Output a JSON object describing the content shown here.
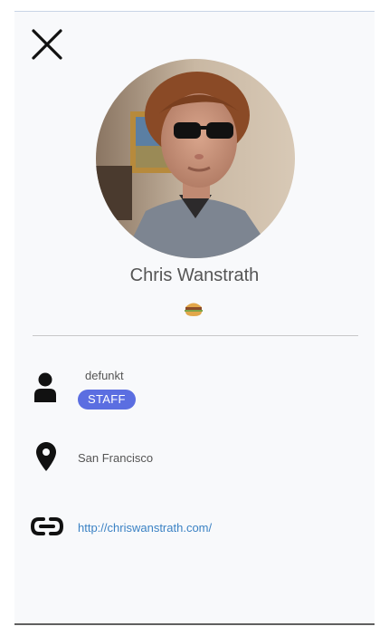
{
  "profile": {
    "name": "Chris Wanstrath",
    "username": "defunkt",
    "badge": "STAFF",
    "location": "San Francisco",
    "website": "http://chriswanstrath.com/"
  },
  "icons": {
    "close": "close-icon",
    "user": "user-icon",
    "location": "location-pin-icon",
    "link": "link-icon",
    "status_emoji": "burger-emoji-icon"
  },
  "colors": {
    "badge": "#5b6ee1",
    "link": "#3b82c4",
    "text": "#555555",
    "background": "#f8f9fb"
  }
}
